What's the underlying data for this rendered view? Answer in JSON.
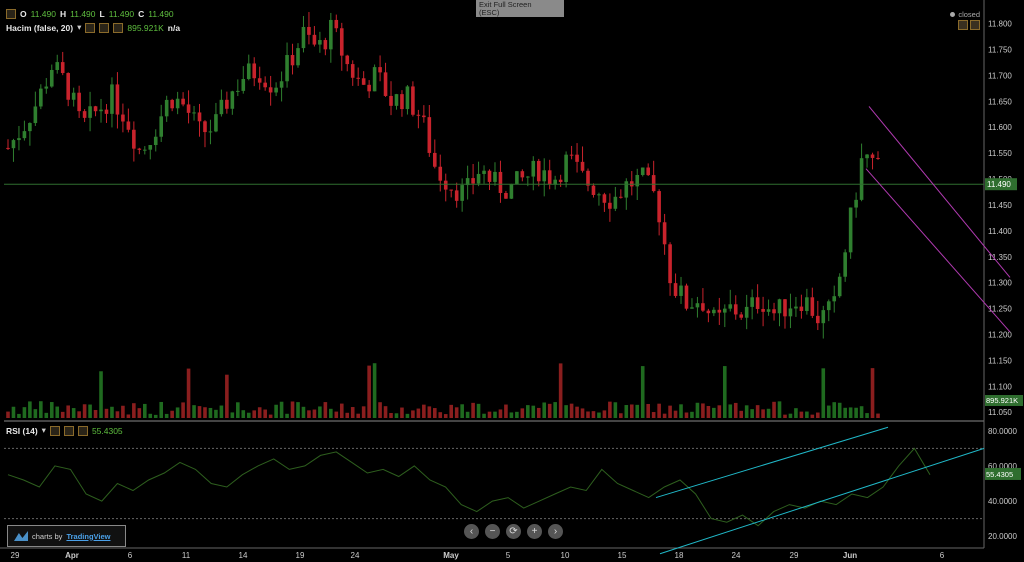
{
  "header": {
    "ohlc": {
      "o_label": "O",
      "o": "11.490",
      "h_label": "H",
      "h": "11.490",
      "l_label": "L",
      "l": "11.490",
      "c_label": "C",
      "c": "11.490"
    },
    "volume_label": "Hacim (false, 20)",
    "volume_value": "895.921K",
    "volume_na": "n/a"
  },
  "rsi_header": {
    "label": "RSI (14)",
    "value": "55.4305"
  },
  "exit_fullscreen": {
    "line1": "Exit Full Screen",
    "line2": "(ESC)"
  },
  "status": {
    "closed": "closed"
  },
  "branding": {
    "prefix": "charts by",
    "name": "TradingView"
  },
  "nav": {
    "prev": "‹",
    "zoom_out": "−",
    "reset": "⟳",
    "zoom_in": "+",
    "next": "›"
  },
  "colors": {
    "up": "#2f7f2f",
    "down": "#c8232c",
    "volume_up": "#1f6a1f",
    "volume_down": "#8a1e1e",
    "price_tag": "#2f6e2f",
    "rsi_line": "#2e5f1e",
    "trend_magenta": "#b03ab0",
    "trend_cyan": "#20b8c8"
  },
  "chart_data": [
    {
      "type": "candlestick",
      "price_axis": {
        "ticks": [
          "11.800",
          "11.750",
          "11.700",
          "11.650",
          "11.600",
          "11.550",
          "11.500",
          "11.450",
          "11.400",
          "11.350",
          "11.300",
          "11.250",
          "11.200",
          "11.150",
          "11.100",
          "11.050"
        ],
        "range": [
          11.035,
          11.83
        ]
      },
      "date_axis": {
        "ticks": [
          "29",
          "Apr",
          "6",
          "11",
          "14",
          "19",
          "24",
          "May",
          "5",
          "10",
          "15",
          "18",
          "24",
          "29",
          "Jun",
          "6"
        ]
      },
      "last_price": {
        "value": 11.49,
        "label": "11.490"
      },
      "volume": {
        "last": "895.921K"
      },
      "series_close": [
        11.56,
        11.6,
        11.65,
        11.72,
        11.68,
        11.6,
        11.63,
        11.66,
        11.62,
        11.55,
        11.6,
        11.66,
        11.64,
        11.59,
        11.6,
        11.66,
        11.7,
        11.71,
        11.68,
        11.72,
        11.78,
        11.75,
        11.79,
        11.72,
        11.68,
        11.7,
        11.65,
        11.66,
        11.62,
        11.52,
        11.49,
        11.47,
        11.52,
        11.49,
        11.48,
        11.5,
        11.52,
        11.5,
        11.54,
        11.5,
        11.48,
        11.46,
        11.49,
        11.5,
        11.46,
        11.3,
        11.26,
        11.27,
        11.22,
        11.25,
        11.24,
        11.27,
        11.24,
        11.26,
        11.27,
        11.23,
        11.25,
        11.4,
        11.55,
        11.52
      ],
      "trendlines": [
        {
          "name": "",
          "color": "magenta",
          "from": [
            "Jun",
            "11.640"
          ],
          "to": [
            "6+",
            "11.310"
          ]
        },
        {
          "name": "",
          "color": "magenta",
          "from": [
            "Jun",
            "11.520"
          ],
          "to": [
            "6+",
            "11.210"
          ]
        }
      ]
    },
    {
      "type": "line",
      "name": "RSI (14)",
      "axis": {
        "ticks": [
          "80.0000",
          "60.0000",
          "40.0000",
          "20.0000"
        ],
        "range": [
          15,
          85
        ],
        "bands": [
          70,
          30
        ]
      },
      "last": {
        "value": 55.4305,
        "label": "55.4305"
      },
      "values": [
        55,
        52,
        48,
        60,
        58,
        44,
        40,
        50,
        46,
        52,
        56,
        62,
        58,
        50,
        48,
        55,
        60,
        64,
        58,
        60,
        66,
        68,
        62,
        56,
        58,
        54,
        60,
        52,
        48,
        38,
        34,
        40,
        42,
        36,
        40,
        44,
        48,
        46,
        58,
        50,
        46,
        42,
        48,
        52,
        44,
        30,
        28,
        32,
        26,
        34,
        38,
        36,
        40,
        38,
        44,
        42,
        48,
        60,
        70,
        55
      ]
    }
  ]
}
